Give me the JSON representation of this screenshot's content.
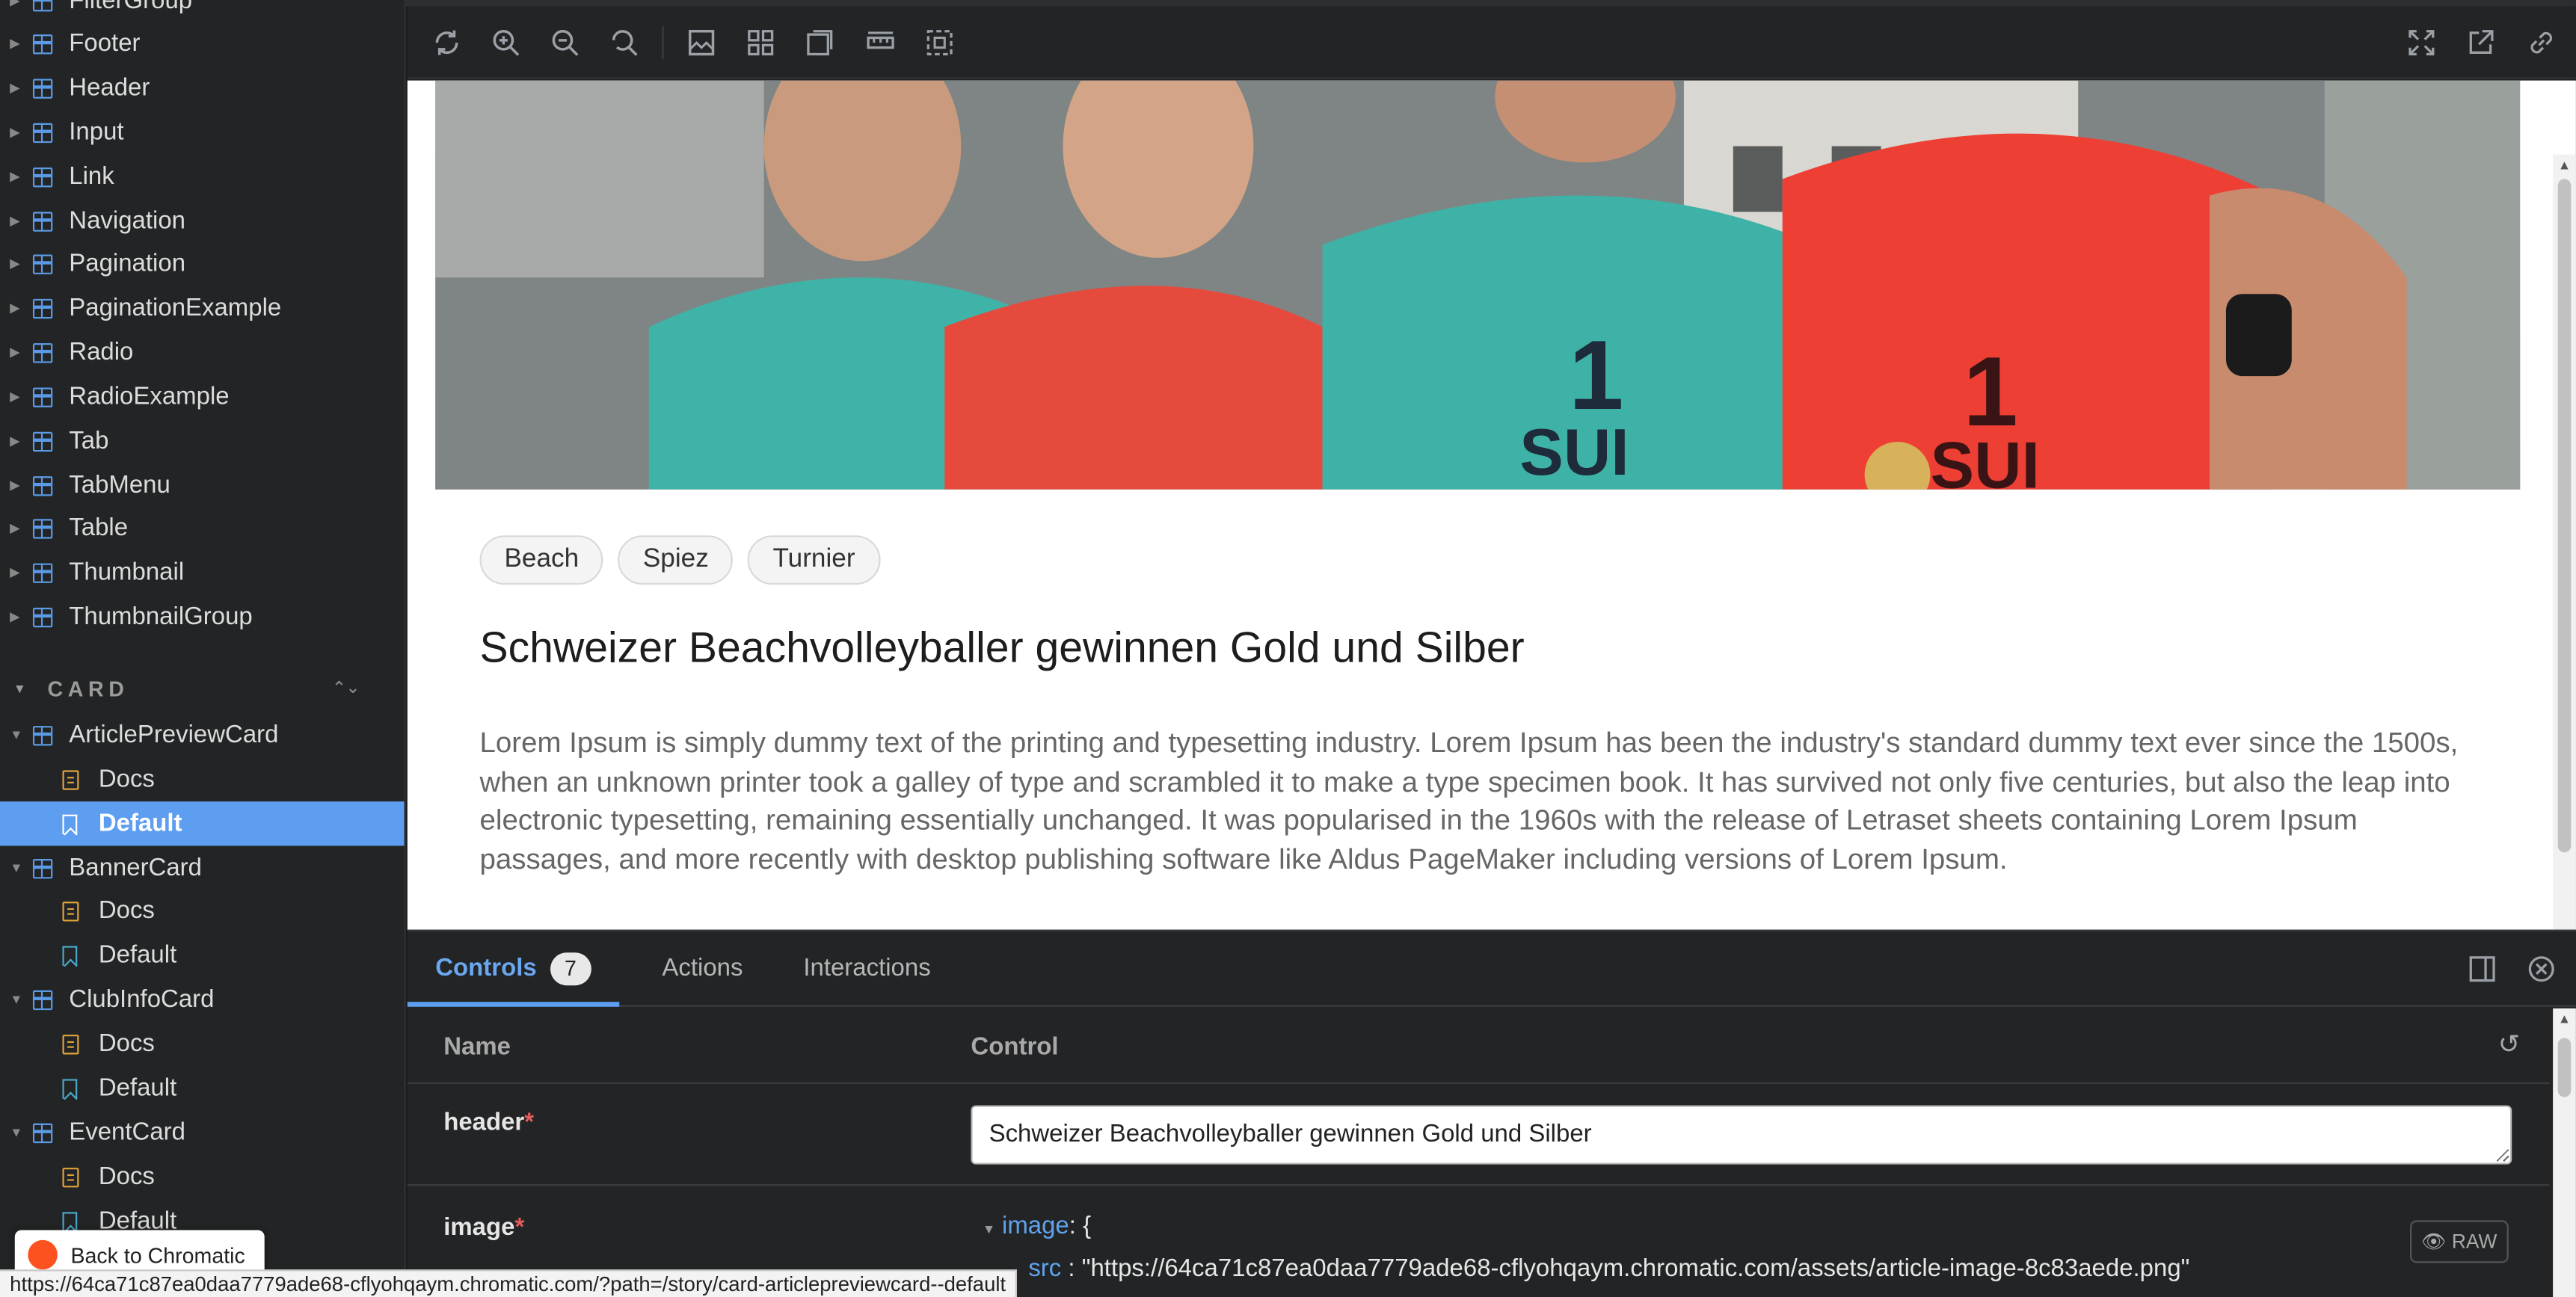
{
  "sidebar": {
    "components": [
      "FilterGroup",
      "Footer",
      "Header",
      "Input",
      "Link",
      "Navigation",
      "Pagination",
      "PaginationExample",
      "Radio",
      "RadioExample",
      "Tab",
      "TabMenu",
      "Table",
      "Thumbnail",
      "ThumbnailGroup"
    ],
    "section_label": "CARD",
    "card_tree": [
      {
        "kind": "component",
        "label": "ArticlePreviewCard"
      },
      {
        "kind": "docs",
        "label": "Docs"
      },
      {
        "kind": "story",
        "label": "Default",
        "selected": true
      },
      {
        "kind": "component",
        "label": "BannerCard"
      },
      {
        "kind": "docs",
        "label": "Docs"
      },
      {
        "kind": "story",
        "label": "Default"
      },
      {
        "kind": "component",
        "label": "ClubInfoCard"
      },
      {
        "kind": "docs",
        "label": "Docs"
      },
      {
        "kind": "story",
        "label": "Default"
      },
      {
        "kind": "component",
        "label": "EventCard"
      },
      {
        "kind": "docs",
        "label": "Docs"
      },
      {
        "kind": "story",
        "label": "Default"
      }
    ],
    "chromatic_button": "Back to Chromatic",
    "partial_text": "Info"
  },
  "status_url": "https://64ca71c87ea0daa7779ade68-cflyohqaym.chromatic.com/?path=/story/card-articlepreviewcard--default",
  "toolbar": {
    "icons": [
      "reload-icon",
      "zoom-in-icon",
      "zoom-out-icon",
      "zoom-reset-icon",
      "background-icon",
      "grid-icon",
      "measure-icon",
      "outline-icon",
      "viewport-icon"
    ],
    "right_icons": [
      "fullscreen-icon",
      "open-new-tab-icon",
      "copy-link-icon"
    ]
  },
  "card": {
    "tags": [
      "Beach",
      "Spiez",
      "Turnier"
    ],
    "title": "Schweizer Beachvolleyballer gewinnen Gold und Silber",
    "body": "Lorem Ipsum is simply dummy text of the printing and typesetting industry. Lorem Ipsum has been the industry's standard dummy text ever since the 1500s, when an unknown printer took a galley of type and scrambled it to make a type specimen book. It has survived not only five centuries, but also the leap into electronic typesetting, remaining essentially unchanged. It was popularised in the 1960s with the release of Letraset sheets containing Lorem Ipsum passages, and more recently with desktop publishing software like Aldus PageMaker including versions of Lorem Ipsum."
  },
  "panel": {
    "tabs": {
      "controls": "Controls",
      "controls_count": "7",
      "actions": "Actions",
      "interactions": "Interactions"
    },
    "col_name": "Name",
    "col_control": "Control",
    "rows": {
      "header_name": "header",
      "header_value": "Schweizer Beachvolleyballer gewinnen Gold und Silber",
      "image_name": "image",
      "image_key": "image",
      "image_brace": ": {",
      "src_key": "src",
      "src_value": ": \"https://64ca71c87ea0daa7779ade68-cflyohqaym.chromatic.com/assets/article-image-8c83aede.png\"",
      "raw_label": "RAW",
      "required_mark": "*"
    }
  },
  "colors": {
    "accent": "#5d9ef0",
    "component_icon": "#5b9ae6",
    "docs_icon": "#e0a33a",
    "story_icon": "#4aa8c8",
    "required": "#e55b5b"
  }
}
